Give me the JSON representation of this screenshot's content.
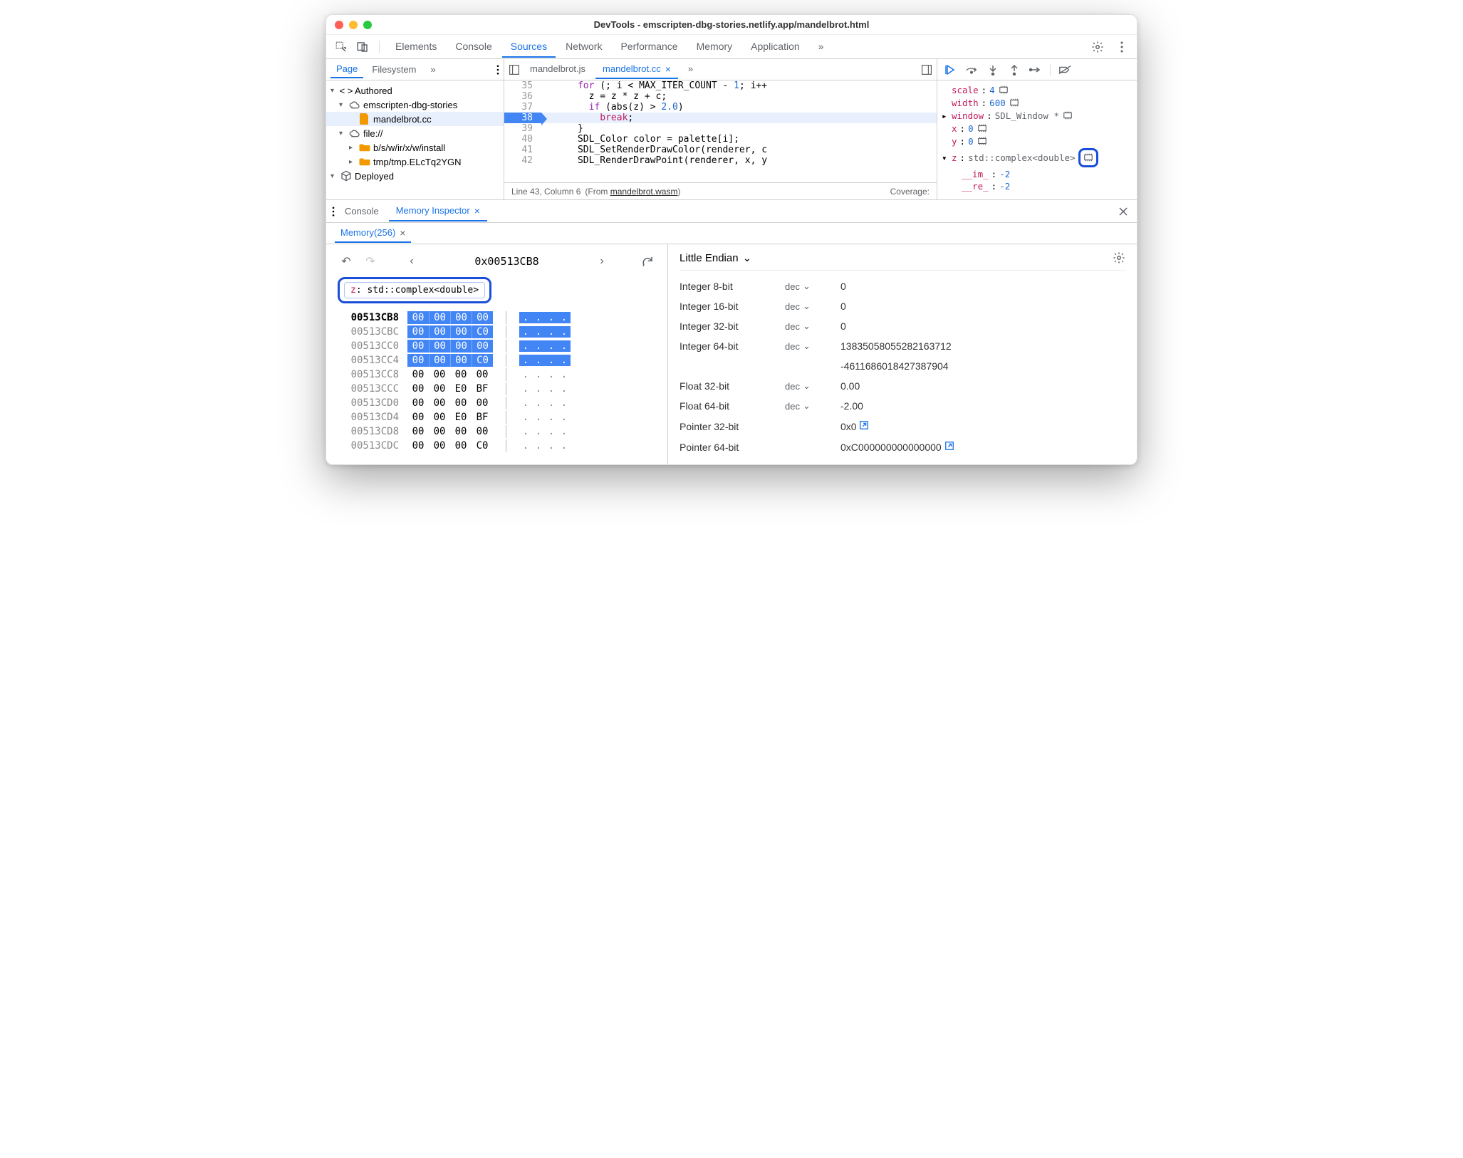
{
  "window": {
    "title": "DevTools - emscripten-dbg-stories.netlify.app/mandelbrot.html"
  },
  "toolbar": {
    "tabs": [
      "Elements",
      "Console",
      "Sources",
      "Network",
      "Performance",
      "Memory",
      "Application"
    ],
    "active": "Sources",
    "more": "»"
  },
  "sidebar": {
    "tabs": [
      "Page",
      "Filesystem"
    ],
    "active": "Page",
    "more": "»",
    "tree": {
      "authored": "Authored",
      "domain1": "emscripten-dbg-stories",
      "file1": "mandelbrot.cc",
      "domain2": "file://",
      "folder1": "b/s/w/ir/x/w/install",
      "folder2": "tmp/tmp.ELcTq2YGN",
      "deployed": "Deployed"
    }
  },
  "editor": {
    "tabs": [
      {
        "label": "mandelbrot.js",
        "active": false
      },
      {
        "label": "mandelbrot.cc",
        "active": true
      }
    ],
    "more": "»",
    "lines": [
      {
        "n": 35,
        "html": "      for (; i < MAX_ITER_COUNT - 1; i++"
      },
      {
        "n": 36,
        "html": "        z = z * z + c;"
      },
      {
        "n": 37,
        "html": "        if (abs(z) > 2.0)"
      },
      {
        "n": 38,
        "html": "          break;",
        "hl": true
      },
      {
        "n": 39,
        "html": "      }"
      },
      {
        "n": 40,
        "html": "      SDL_Color color = palette[i];"
      },
      {
        "n": 41,
        "html": "      SDL_SetRenderDrawColor(renderer, co"
      },
      {
        "n": 42,
        "html": "      SDL_RenderDrawPoint(renderer, x, y"
      }
    ],
    "status": {
      "pos": "Line 43, Column 6",
      "from": "(From ",
      "link": "mandelbrot.wasm",
      "close": ")",
      "coverage": "Coverage:"
    }
  },
  "scope": {
    "items": [
      {
        "arrow": "",
        "key": "scale",
        "val": "4",
        "icon": true
      },
      {
        "arrow": "",
        "key": "width",
        "val": "600",
        "icon": true
      },
      {
        "arrow": "▸",
        "key": "window",
        "val": "SDL_Window *",
        "icon": true
      },
      {
        "arrow": "",
        "key": "x",
        "val": "0",
        "icon": true
      },
      {
        "arrow": "",
        "key": "y",
        "val": "0",
        "icon": true
      },
      {
        "arrow": "▾",
        "key": "z",
        "val": "std::complex<double>",
        "icon": true,
        "ring": true
      }
    ],
    "z_children": [
      {
        "key": "__im_",
        "val": "-2"
      },
      {
        "key": "__re_",
        "val": "-2"
      }
    ]
  },
  "drawer": {
    "tabs": [
      "Console",
      "Memory Inspector"
    ],
    "active": "Memory Inspector",
    "subtab": "Memory(256)"
  },
  "memory": {
    "address": "0x00513CB8",
    "chip": {
      "key": "z",
      "type": "std::complex<double>"
    },
    "rows": [
      {
        "addr": "00513CB8",
        "bold": true,
        "bytes": [
          "00",
          "00",
          "00",
          "00"
        ],
        "hl": true
      },
      {
        "addr": "00513CBC",
        "bytes": [
          "00",
          "00",
          "00",
          "C0"
        ],
        "hl": true
      },
      {
        "addr": "00513CC0",
        "bytes": [
          "00",
          "00",
          "00",
          "00"
        ],
        "hl": true
      },
      {
        "addr": "00513CC4",
        "bytes": [
          "00",
          "00",
          "00",
          "C0"
        ],
        "hl": true
      },
      {
        "addr": "00513CC8",
        "bytes": [
          "00",
          "00",
          "00",
          "00"
        ],
        "hl": false
      },
      {
        "addr": "00513CCC",
        "bytes": [
          "00",
          "00",
          "E0",
          "BF"
        ],
        "hl": false
      },
      {
        "addr": "00513CD0",
        "bytes": [
          "00",
          "00",
          "00",
          "00"
        ],
        "hl": false
      },
      {
        "addr": "00513CD4",
        "bytes": [
          "00",
          "00",
          "E0",
          "BF"
        ],
        "hl": false
      },
      {
        "addr": "00513CD8",
        "bytes": [
          "00",
          "00",
          "00",
          "00"
        ],
        "hl": false
      },
      {
        "addr": "00513CDC",
        "bytes": [
          "00",
          "00",
          "00",
          "C0"
        ],
        "hl": false
      }
    ],
    "endian": "Little Endian",
    "values": [
      {
        "type": "Integer 8-bit",
        "fmt": "dec",
        "value": "0"
      },
      {
        "type": "Integer 16-bit",
        "fmt": "dec",
        "value": "0"
      },
      {
        "type": "Integer 32-bit",
        "fmt": "dec",
        "value": "0"
      },
      {
        "type": "Integer 64-bit",
        "fmt": "dec",
        "value": "13835058055282163712"
      },
      {
        "type": "",
        "fmt": "",
        "value": "-4611686018427387904"
      },
      {
        "type": "Float 32-bit",
        "fmt": "dec",
        "value": "0.00"
      },
      {
        "type": "Float 64-bit",
        "fmt": "dec",
        "value": "-2.00"
      },
      {
        "type": "Pointer 32-bit",
        "fmt": "",
        "value": "0x0",
        "link": true
      },
      {
        "type": "Pointer 64-bit",
        "fmt": "",
        "value": "0xC000000000000000",
        "link": true
      }
    ]
  }
}
